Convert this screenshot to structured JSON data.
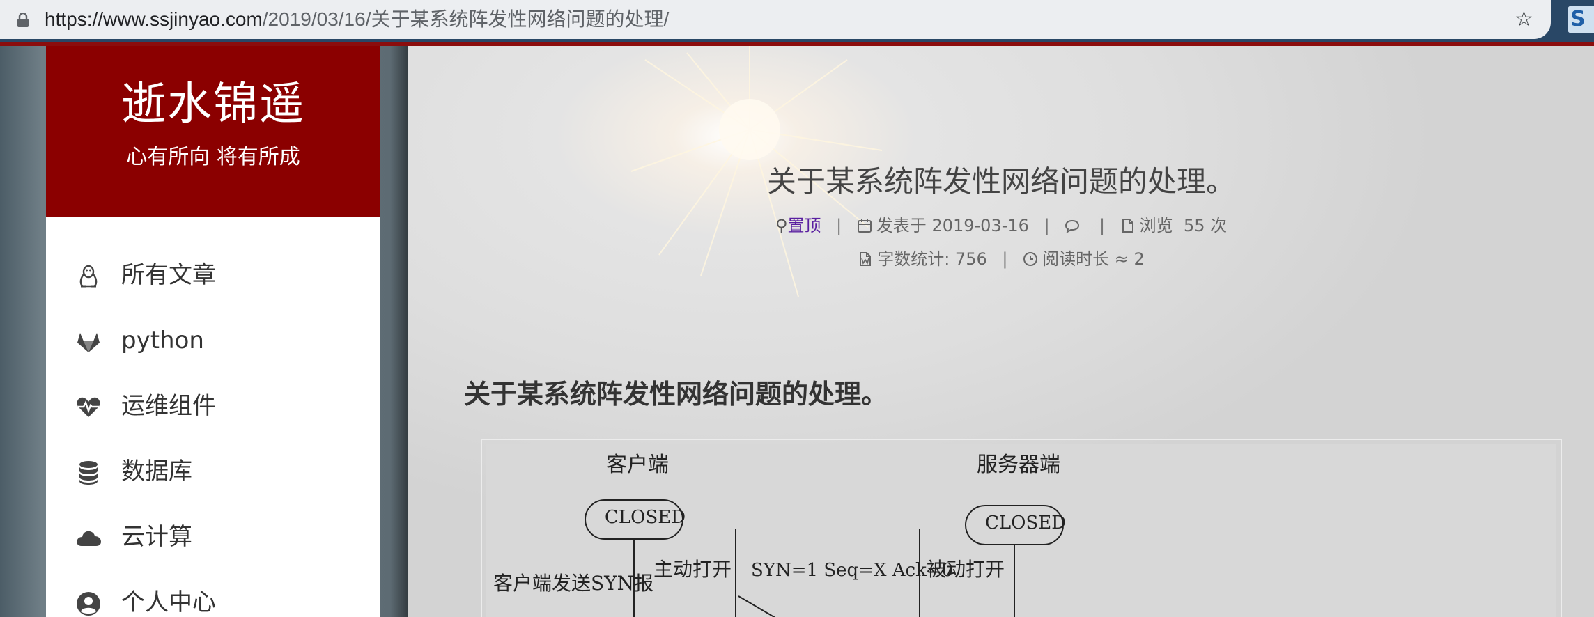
{
  "browser": {
    "url_host": "https://www.ssjinyao.com",
    "url_path": "/2019/03/16/关于某系统阵发性网络问题的处理/",
    "extension_letter": "S"
  },
  "sidebar": {
    "title": "逝水锦遥",
    "subtitle": "心有所向 将有所成",
    "items": [
      {
        "label": "所有文章",
        "icon": "penguin-icon"
      },
      {
        "label": "python",
        "icon": "gitlab-icon"
      },
      {
        "label": "运维组件",
        "icon": "heartbeat-icon"
      },
      {
        "label": "数据库",
        "icon": "database-icon"
      },
      {
        "label": "云计算",
        "icon": "cloud-icon"
      },
      {
        "label": "个人中心",
        "icon": "user-circle-icon"
      }
    ]
  },
  "post": {
    "title": "关于某系统阵发性网络问题的处理。",
    "pinned": "置顶",
    "published": "发表于 2019-03-16",
    "views_label": "浏览",
    "views_count": "55",
    "views_unit": "次",
    "word_count": "字数统计: 756",
    "read_time": "阅读时长 ≈ 2",
    "heading": "关于某系统阵发性网络问题的处理。"
  },
  "figure": {
    "client_label": "客户端",
    "server_label": "服务器端",
    "client_state": "CLOSED",
    "server_state": "CLOSED",
    "active_open": "主动打开",
    "passive_open": "被动打开",
    "syn_packet": "SYN=1  Seq=X  Ack=0",
    "client_send_note": "客户端发送SYN报"
  },
  "colors": {
    "brand_red": "#8b0000",
    "address_bar_bg": "#eceef1",
    "browser_frame": "#294766",
    "link_purple": "#5a1fa0"
  }
}
